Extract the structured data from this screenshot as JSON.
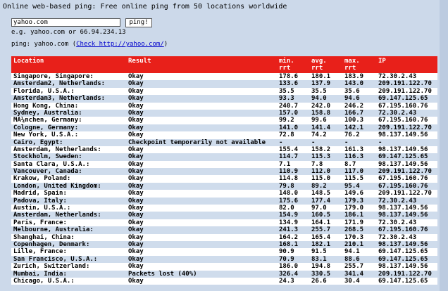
{
  "title": "Online web-based ping: Free online ping from 50 locations worldwide",
  "form": {
    "host_value": "yahoo.com",
    "button_label": "ping!",
    "example": "e.g. yahoo.com or 66.94.234.13"
  },
  "ping": {
    "prefix": "ping: yahoo.com (",
    "link": "Check http://yahoo.com/",
    "suffix": ")"
  },
  "table": {
    "headers": [
      "Location",
      "Result",
      "min. rrt",
      "avg. rrt",
      "max. rrt",
      "IP"
    ],
    "rows": [
      [
        "Singapore, Singapore:",
        "Okay",
        "178.6",
        "180.1",
        "183.9",
        "72.30.2.43"
      ],
      [
        "Amsterdam2, Netherlands:",
        "Okay",
        "133.6",
        "137.9",
        "143.0",
        "209.191.122.70"
      ],
      [
        "Florida, U.S.A.:",
        "Okay",
        "35.5",
        "35.5",
        "35.6",
        "209.191.122.70"
      ],
      [
        "Amsterdam3, Netherlands:",
        "Okay",
        "93.3",
        "94.0",
        "94.6",
        "69.147.125.65"
      ],
      [
        "Hong Kong, China:",
        "Okay",
        "240.7",
        "242.0",
        "246.2",
        "67.195.160.76"
      ],
      [
        "Sydney, Australia:",
        "Okay",
        "157.0",
        "158.8",
        "166.7",
        "72.30.2.43"
      ],
      [
        "MÃ¼nchen, Germany:",
        "Okay",
        "99.2",
        "99.6",
        "100.3",
        "67.195.160.76"
      ],
      [
        "Cologne, Germany:",
        "Okay",
        "141.0",
        "141.4",
        "142.1",
        "209.191.122.70"
      ],
      [
        "New York, U.S.A.:",
        "Okay",
        "72.8",
        "74.2",
        "76.2",
        "98.137.149.56"
      ],
      [
        "Cairo, Egypt:",
        "Checkpoint temporarily not available",
        "-",
        "-",
        "-",
        "-"
      ],
      [
        "Amsterdam, Netherlands:",
        "Okay",
        "155.4",
        "158.2",
        "161.3",
        "98.137.149.56"
      ],
      [
        "Stockholm, Sweden:",
        "Okay",
        "114.7",
        "115.3",
        "116.3",
        "69.147.125.65"
      ],
      [
        "Santa Clara, U.S.A.:",
        "Okay",
        "7.1",
        "7.8",
        "8.7",
        "98.137.149.56"
      ],
      [
        "Vancouver, Canada:",
        "Okay",
        "110.9",
        "112.0",
        "117.0",
        "209.191.122.70"
      ],
      [
        "Krakow, Poland:",
        "Okay",
        "114.8",
        "115.0",
        "115.5",
        "67.195.160.76"
      ],
      [
        "London, United Kingdom:",
        "Okay",
        "79.8",
        "89.2",
        "95.4",
        "67.195.160.76"
      ],
      [
        "Madrid, Spain:",
        "Okay",
        "148.0",
        "148.5",
        "149.6",
        "209.191.122.70"
      ],
      [
        "Padova, Italy:",
        "Okay",
        "175.6",
        "177.4",
        "179.3",
        "72.30.2.43"
      ],
      [
        "Austin, U.S.A.:",
        "Okay",
        "82.0",
        "97.0",
        "179.0",
        "98.137.149.56"
      ],
      [
        "Amsterdam, Netherlands:",
        "Okay",
        "154.9",
        "160.5",
        "186.1",
        "98.137.149.56"
      ],
      [
        "Paris, France:",
        "Okay",
        "134.9",
        "164.1",
        "171.9",
        "72.30.2.43"
      ],
      [
        "Melbourne, Australia:",
        "Okay",
        "241.3",
        "255.7",
        "268.5",
        "67.195.160.76"
      ],
      [
        "Shanghai, China:",
        "Okay",
        "164.2",
        "165.4",
        "170.3",
        "72.30.2.43"
      ],
      [
        "Copenhagen, Denmark:",
        "Okay",
        "168.1",
        "182.1",
        "210.1",
        "98.137.149.56"
      ],
      [
        "Lille, France:",
        "Okay",
        "90.9",
        "91.5",
        "94.1",
        "69.147.125.65"
      ],
      [
        "San Francisco, U.S.A.:",
        "Okay",
        "70.9",
        "83.1",
        "88.6",
        "69.147.125.65"
      ],
      [
        "Zurich, Switzerland:",
        "Okay",
        "186.0",
        "194.8",
        "255.7",
        "98.137.149.56"
      ],
      [
        "Mumbai, India:",
        "Packets lost (40%)",
        "326.4",
        "330.5",
        "341.4",
        "209.191.122.70"
      ],
      [
        "Chicago, U.S.A.:",
        "Okay",
        "24.3",
        "26.6",
        "30.4",
        "69.147.125.65"
      ]
    ]
  }
}
